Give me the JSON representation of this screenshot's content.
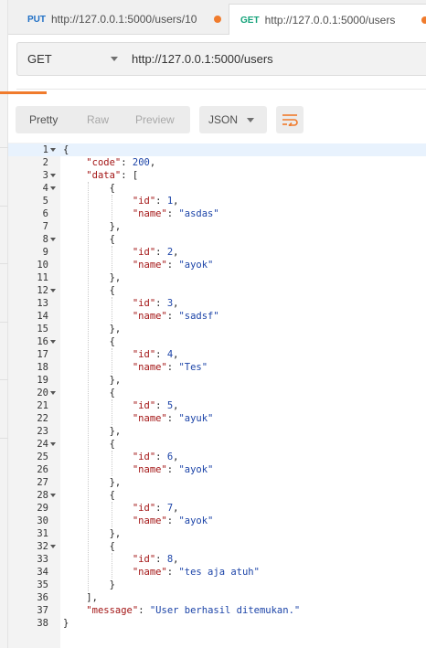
{
  "tabs": [
    {
      "method": "PUT",
      "url": "http://127.0.0.1:5000/users/10"
    },
    {
      "method": "GET",
      "url": "http://127.0.0.1:5000/users"
    }
  ],
  "request": {
    "method": "GET",
    "url": "http://127.0.0.1:5000/users"
  },
  "response_toolbar": {
    "view_modes": [
      "Pretty",
      "Raw",
      "Preview"
    ],
    "selected_view": "Pretty",
    "format": "JSON"
  },
  "colors": {
    "accent": "#f07b2c",
    "put_method": "#1f6fc5",
    "get_method": "#15a37a",
    "json_key": "#a31515",
    "json_value": "#1c44a8"
  },
  "icons": [
    "wrap-lines-icon",
    "chevron-down-icon",
    "fold-arrow-icon"
  ],
  "editor": {
    "lines": [
      "{",
      "    \"code\": 200,",
      "    \"data\": [",
      "        {",
      "            \"id\": 1,",
      "            \"name\": \"asdas\"",
      "        },",
      "        {",
      "            \"id\": 2,",
      "            \"name\": \"ayok\"",
      "        },",
      "        {",
      "            \"id\": 3,",
      "            \"name\": \"sadsf\"",
      "        },",
      "        {",
      "            \"id\": 4,",
      "            \"name\": \"Tes\"",
      "        },",
      "        {",
      "            \"id\": 5,",
      "            \"name\": \"ayuk\"",
      "        },",
      "        {",
      "            \"id\": 6,",
      "            \"name\": \"ayok\"",
      "        },",
      "        {",
      "            \"id\": 7,",
      "            \"name\": \"ayok\"",
      "        },",
      "        {",
      "            \"id\": 8,",
      "            \"name\": \"tes aja atuh\"",
      "        }",
      "    ],",
      "    \"message\": \"User berhasil ditemukan.\"",
      "}"
    ],
    "foldable_lines": [
      1,
      3,
      4,
      8,
      12,
      16,
      20,
      24,
      28,
      32
    ],
    "active_line": 1
  }
}
